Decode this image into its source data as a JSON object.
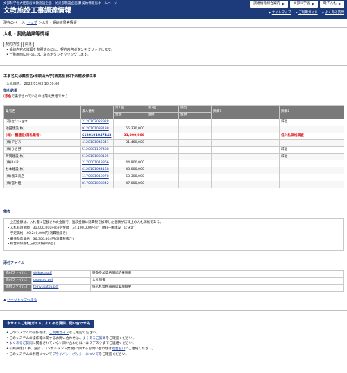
{
  "header": {
    "ministry_line": "文部科学省大臣官房文教施設企画・防災部施設企画課 契約情報省ホームページ",
    "title": "文教施設工事調達情報",
    "top_buttons": [
      "調達情報総合案内",
      "文部科学省",
      "電子入札"
    ],
    "links": [
      "サイトマップ",
      "ご利用ガイド",
      "よくある質問"
    ]
  },
  "breadcrumb": {
    "prefix": "現在のページ:",
    "top": "トップ",
    "sep": "＞",
    "current": "入札・契約結果等情報"
  },
  "page_title": "入札・契約結果等情報",
  "buttons": {
    "contract": "契約内容",
    "back": "戻る"
  },
  "notes": [
    "契約内容の詳細を参照するには、契約内容ボタンをクリックします。",
    "一覧画面に戻るには、戻るボタンをクリックします。"
  ],
  "project": {
    "name": "工事名又は業務名:和歌山大学(西高松)和下余館改修工事",
    "date": "入札日時:　2022/03/03 10:30:00"
  },
  "result": {
    "heading": "落札結果",
    "note_pre": "(",
    "note_red": "赤色",
    "note_post": "で表示されているのは落札業者です。)",
    "headers_top": [
      "業者名",
      "法人番号",
      "第1回",
      "第2回",
      "随契",
      "摘要1",
      "摘要2"
    ],
    "headers_sub": [
      "金額",
      "金額",
      "金額"
    ],
    "rows": [
      {
        "name": "(有)センショウ",
        "num": "2120102022928",
        "r1": "",
        "r2": "",
        "zk": "",
        "t1": "",
        "t2": "辞退",
        "win": false
      },
      {
        "name": "池田建設(株)",
        "num": "9120101038138",
        "r1": "55,330,000",
        "r2": "",
        "zk": "",
        "t1": "",
        "t2": "",
        "win": false
      },
      {
        "name": "(株)一鵬建設(落札業者)",
        "num": "6120101047443",
        "r1": "31,000,000",
        "r2": "",
        "zk": "",
        "t1": "",
        "t2": "低入札価格調査",
        "win": true
      },
      {
        "name": "(株)アピス",
        "num": "4120101045341",
        "r1": "31,460,000",
        "r2": "",
        "zk": "",
        "t1": "",
        "t2": "",
        "win": false
      },
      {
        "name": "(株)ひさ野",
        "num": "5120001197488",
        "r1": "",
        "r2": "",
        "zk": "",
        "t1": "",
        "t2": "辞退",
        "win": false
      },
      {
        "name": "時岡建設(株)",
        "num": "5120101038105",
        "r1": "",
        "r2": "",
        "zk": "",
        "t1": "",
        "t2": "辞退",
        "win": false
      },
      {
        "name": "(株)RaiR",
        "num": "2170001013866",
        "r1": "44,900,000",
        "r2": "",
        "zk": "",
        "t1": "",
        "t2": "",
        "win": false
      },
      {
        "name": "杉本建設(株)",
        "num": "6120101044168",
        "r1": "48,000,000",
        "r2": "",
        "zk": "",
        "t1": "",
        "t2": "",
        "win": false
      },
      {
        "name": "(株)楓工商店",
        "num": "1170001010278",
        "r1": "53,300,000",
        "r2": "",
        "zk": "",
        "t1": "",
        "t2": "",
        "win": false
      },
      {
        "name": "(株)宮井組",
        "num": "8170001003242",
        "r1": "47,000,000",
        "r2": "",
        "zk": "",
        "t1": "",
        "t2": "",
        "win": false
      }
    ]
  },
  "remarks": {
    "heading": "備考",
    "lines": [
      "・上記金額は、入札書に記載された金額で、当該金額に消費税を加算した金額が法律上の入札価格である。",
      "・入札経過金額　31,000,000円(決定金額　34,100,000円)で　(株)一鵬建設　に決定",
      "・予定価格　40,240,000円(消費税抜き)",
      "・最低基準価格　36,306,804円(消費税抜き)",
      "・総合評価落札方式[実績評価型]"
    ]
  },
  "attachments": {
    "heading": "添付ファイル",
    "rows": [
      {
        "label": "添付ファイル1",
        "file": "shikaku.pdf",
        "desc": "競争参加資格確認結果調書"
      },
      {
        "label": "添付ファイル2",
        "file": "cyousyo.pdf",
        "desc": "入札調書"
      },
      {
        "label": "添付ファイル3",
        "file": "teinyusatsu.pdf",
        "desc": "低入札価格調査の実施概要"
      }
    ]
  },
  "page_top": "ページトップへ戻る",
  "guide": {
    "title": "本サイトご利用ガイド、よくある質問、問い合わせ先",
    "items": [
      {
        "pre": "このシステムの操作等は、",
        "link": "ご利用ガイド",
        "post": "をご確認ください。"
      },
      {
        "pre": "このシステムの操作等に関するお問い合わせは、",
        "link": "よくあるご質問",
        "post": "をご確認ください。"
      },
      {
        "pre": "",
        "link": "よくあるご質問",
        "post": "に掲載されていない問い合わせはヘルプデスクまでご連絡ください。"
      },
      {
        "pre": "公共調達(工事、設計・コンサルタント業務)に関するお問い合わせは",
        "link": "総合窓口",
        "post": "にご連絡ください。"
      },
      {
        "pre": "このシステムの利用について",
        "link": "プライバシーポリシーについて",
        "post": "をご確認ください。"
      }
    ]
  }
}
